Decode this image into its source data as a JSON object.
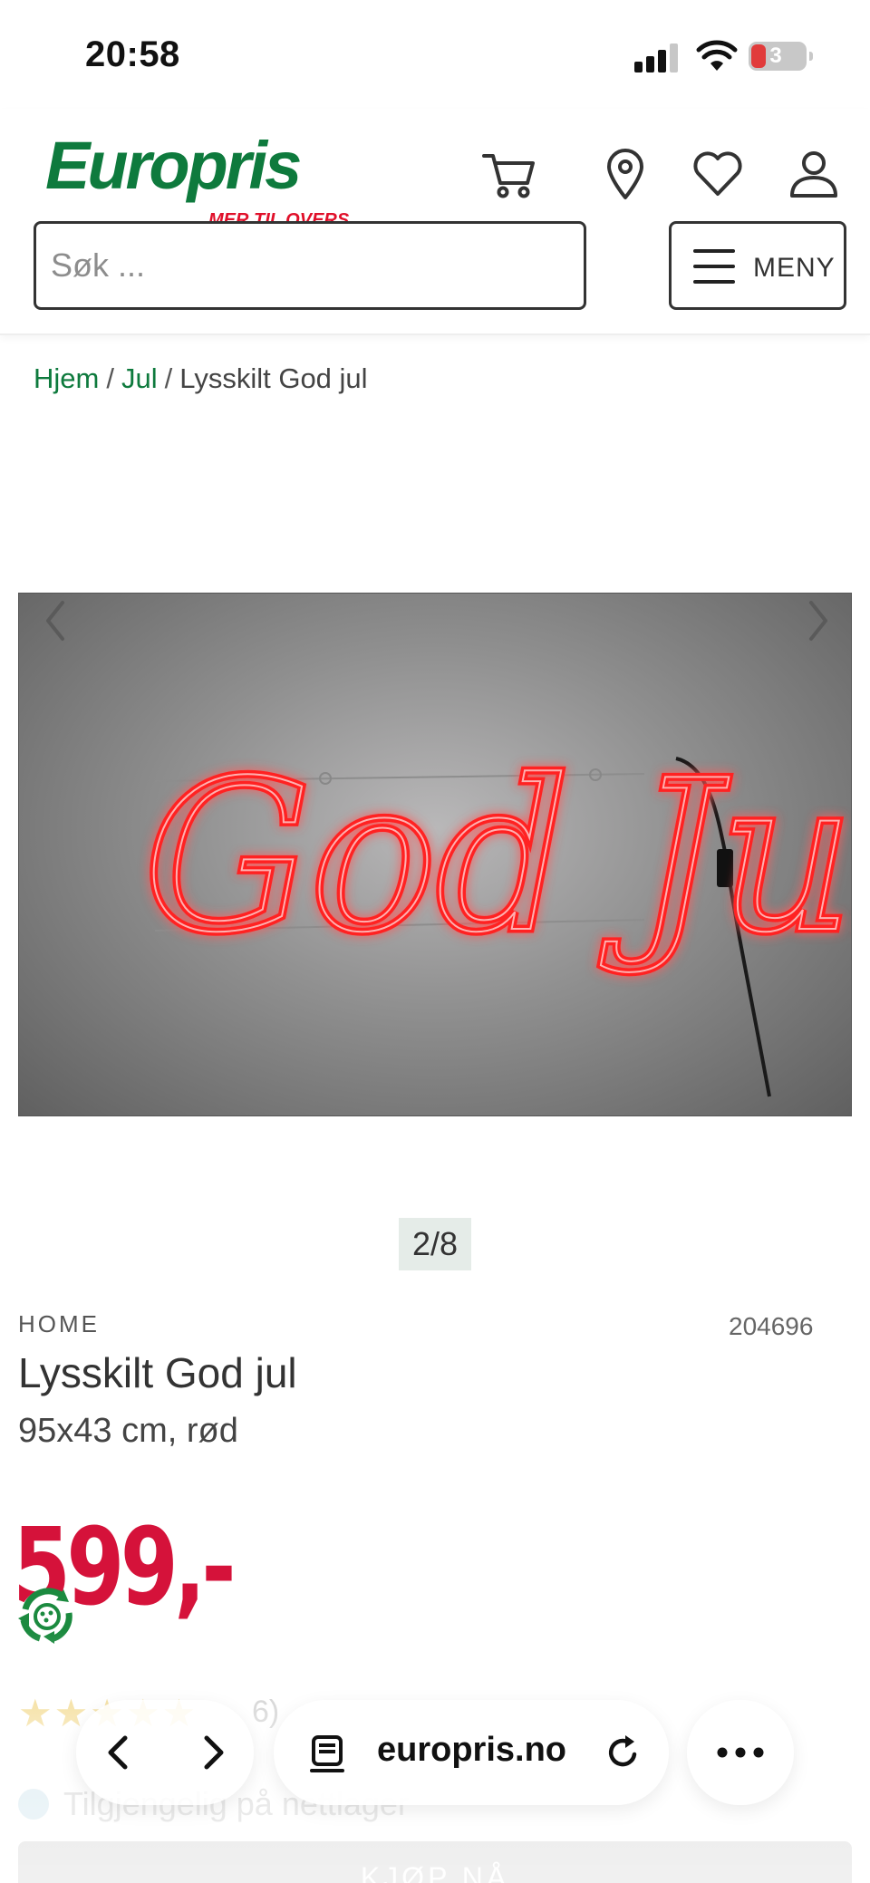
{
  "status_bar": {
    "time": "20:58",
    "battery": "3"
  },
  "header": {
    "logo": {
      "brand": "Europris",
      "tagline": "MER TIL OVERS"
    },
    "search_placeholder": "Søk ...",
    "menu_label": "MENY",
    "icons": [
      "cart-icon",
      "location-pin-icon",
      "heart-icon",
      "user-icon"
    ]
  },
  "breadcrumb": {
    "home": "Hjem",
    "category": "Jul",
    "separator": "/",
    "current": "Lysskilt God jul"
  },
  "gallery": {
    "counter": "2/8",
    "image_text": "God Jul"
  },
  "product": {
    "brand": "HOME",
    "sku": "204696",
    "title": "Lysskilt God jul",
    "subtitle": "95x43 cm, rød",
    "price": "599,-",
    "reviews_count": "6)",
    "availability": "Tilgjengelig på nettlager",
    "buy_label": "KJØP NÅ"
  },
  "browser": {
    "domain": "europris.no"
  },
  "colors": {
    "brand_green": "#0e7a3d",
    "price_red": "#d5123a",
    "neon_red": "#ff1a1a"
  }
}
